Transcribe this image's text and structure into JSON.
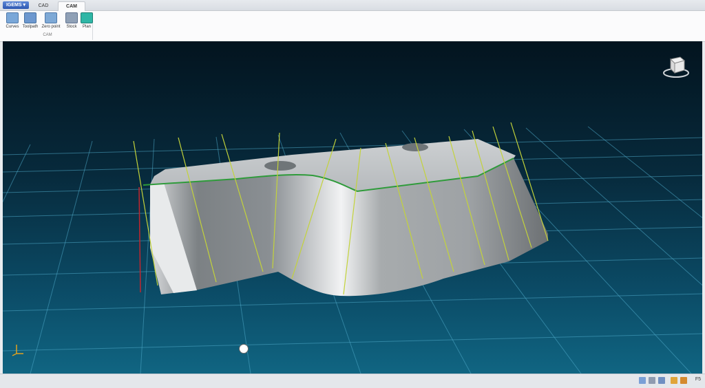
{
  "app": {
    "menu_button": "IGEMS ▾",
    "tabs": [
      "CAD",
      "CAM"
    ],
    "active_tab": "CAM"
  },
  "ribbon": {
    "group_label": "CAM",
    "tools": [
      {
        "label": "Curves",
        "icon": "curves-icon",
        "color": "#7aa7d8"
      },
      {
        "label": "Toolpath",
        "icon": "toolpath-icon",
        "color": "#6d98cf"
      },
      {
        "label": "Zero point",
        "icon": "zero-point-icon",
        "color": "#7ea9d6"
      },
      {
        "label": "Stock",
        "icon": "stock-icon",
        "color": "#8fa0b6"
      },
      {
        "label": "Plan",
        "icon": "plan-icon",
        "color": "#2fb6a6"
      }
    ]
  },
  "viewport": {
    "nav_cube_icon": "view-cube-icon",
    "axis_icon": "axis-triad-icon",
    "cursor_icon": "rotate-cursor-icon"
  },
  "statusbar": {
    "text": "F5",
    "icons": [
      "grid-icon",
      "layers-icon",
      "view-icon",
      "folder-icon",
      "settings-icon"
    ]
  },
  "colors": {
    "background_top": "#03141f",
    "background_bottom": "#106582",
    "grid": "#4ea9c9",
    "part": "#bfc3c6",
    "toolpath_lines": "#c3d33a",
    "contour": "#2e9b3a"
  }
}
